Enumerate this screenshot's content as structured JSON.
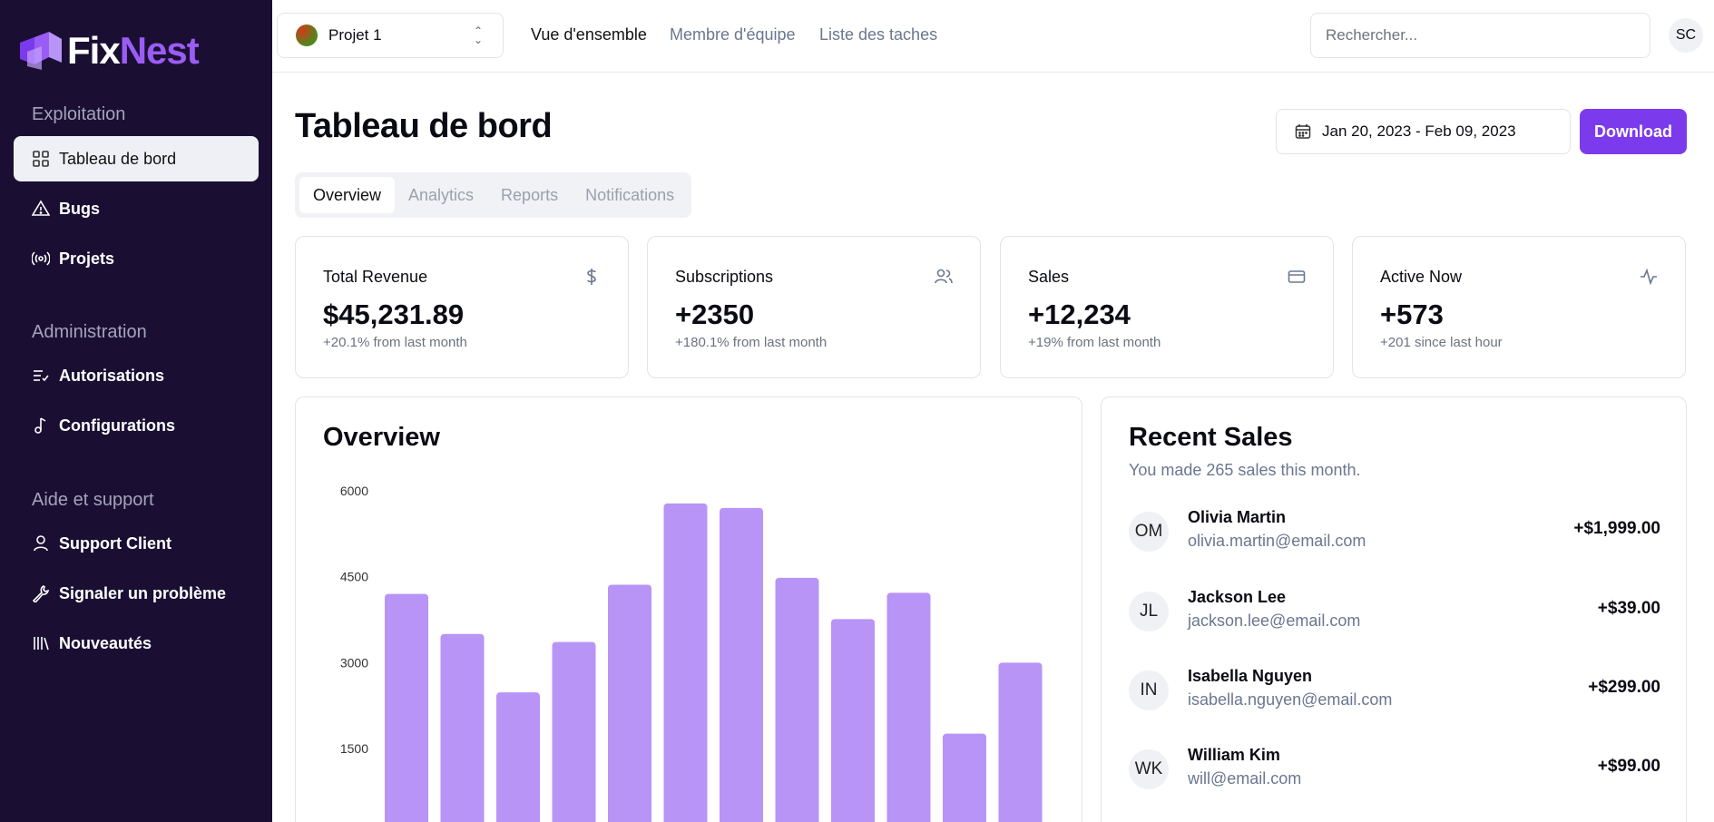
{
  "brand": {
    "fix": "Fix",
    "nest": "Nest",
    "accent": "#7c3aed"
  },
  "sidebar": {
    "sections": [
      {
        "title": "Exploitation",
        "items": [
          {
            "label": "Tableau de bord",
            "icon": "grid-icon",
            "active": true
          },
          {
            "label": "Bugs",
            "icon": "warning-icon"
          },
          {
            "label": "Projets",
            "icon": "broadcast-icon"
          }
        ]
      },
      {
        "title": "Administration",
        "items": [
          {
            "label": "Autorisations",
            "icon": "list-check-icon"
          },
          {
            "label": "Configurations",
            "icon": "music-note-icon"
          }
        ]
      },
      {
        "title": "Aide et support",
        "items": [
          {
            "label": "Support Client",
            "icon": "user-icon"
          },
          {
            "label": "Signaler un problème",
            "icon": "wrench-icon"
          },
          {
            "label": "Nouveautés",
            "icon": "library-icon"
          }
        ]
      }
    ]
  },
  "topbar": {
    "project": "Projet 1",
    "links": [
      "Vue d'ensemble",
      "Membre d'équipe",
      "Liste des taches"
    ],
    "search_placeholder": "Rechercher...",
    "avatar": "SC"
  },
  "main": {
    "title": "Tableau de bord",
    "date_range": "Jan 20, 2023 - Feb 09, 2023",
    "download_label": "Download",
    "tabs": [
      "Overview",
      "Analytics",
      "Reports",
      "Notifications"
    ]
  },
  "stats": [
    {
      "title": "Total Revenue",
      "value": "$45,231.89",
      "sub": "+20.1% from last month",
      "icon": "dollar-icon"
    },
    {
      "title": "Subscriptions",
      "value": "+2350",
      "sub": "+180.1% from last month",
      "icon": "users-icon"
    },
    {
      "title": "Sales",
      "value": "+12,234",
      "sub": "+19% from last month",
      "icon": "credit-card-icon"
    },
    {
      "title": "Active Now",
      "value": "+573",
      "sub": "+201 since last hour",
      "icon": "activity-icon"
    }
  ],
  "overview": {
    "title": "Overview"
  },
  "chart_data": {
    "type": "bar",
    "title": "Overview",
    "yticks": [
      6000,
      4500,
      3000,
      1500
    ],
    "values": [
      4200,
      3500,
      2480,
      3360,
      4360,
      5780,
      5700,
      4480,
      3760,
      4220,
      1760,
      3000
    ],
    "color": "#b794f6"
  },
  "recent_sales": {
    "title": "Recent Sales",
    "subtitle": "You made 265 sales this month.",
    "rows": [
      {
        "initials": "OM",
        "name": "Olivia Martin",
        "email": "olivia.martin@email.com",
        "amount": "+$1,999.00"
      },
      {
        "initials": "JL",
        "name": "Jackson Lee",
        "email": "jackson.lee@email.com",
        "amount": "+$39.00"
      },
      {
        "initials": "IN",
        "name": "Isabella Nguyen",
        "email": "isabella.nguyen@email.com",
        "amount": "+$299.00"
      },
      {
        "initials": "WK",
        "name": "William Kim",
        "email": "will@email.com",
        "amount": "+$99.00"
      }
    ]
  }
}
